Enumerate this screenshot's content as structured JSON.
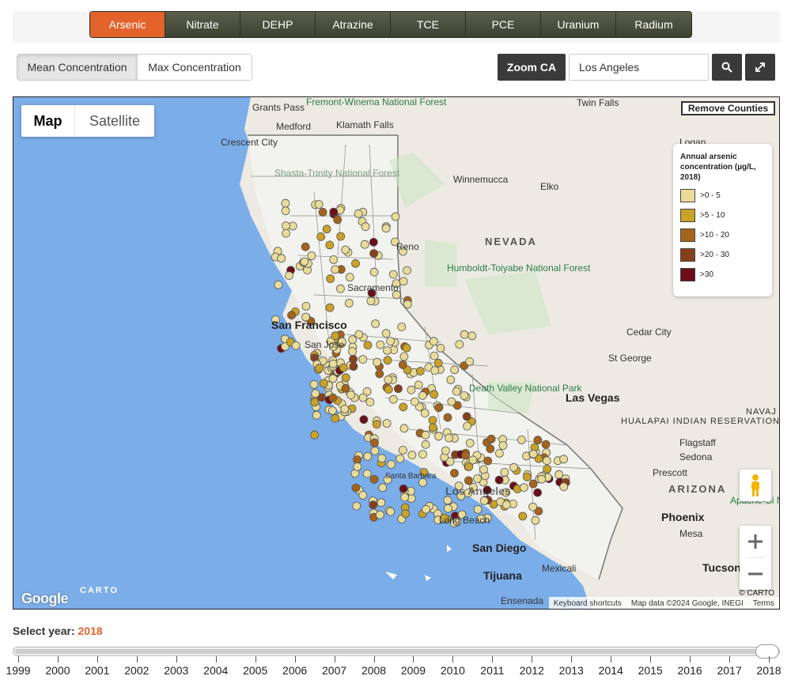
{
  "contaminant_tabs": [
    {
      "label": "Arsenic",
      "active": true
    },
    {
      "label": "Nitrate",
      "active": false
    },
    {
      "label": "DEHP",
      "active": false
    },
    {
      "label": "Atrazine",
      "active": false
    },
    {
      "label": "TCE",
      "active": false
    },
    {
      "label": "PCE",
      "active": false
    },
    {
      "label": "Uranium",
      "active": false
    },
    {
      "label": "Radium",
      "active": false
    }
  ],
  "concentration": {
    "mean_label": "Mean Concentration",
    "max_label": "Max Concentration",
    "selected": "mean"
  },
  "toolbar": {
    "zoom_label": "Zoom CA",
    "search_value": "Los Angeles",
    "search_icon": "search-icon",
    "expand_icon": "expand-icon"
  },
  "map": {
    "map_type_map": "Map",
    "map_type_satellite": "Satellite",
    "selected_type": "Map",
    "remove_counties_label": "Remove Counties",
    "place_labels": [
      "Grants Pass",
      "Fremont-Winema National Forest",
      "Medford",
      "Klamath Falls",
      "Crescent City",
      "Twin Falls",
      "Logan",
      "Shasta-Trinity National Forest",
      "Winnemucca",
      "Elko",
      "Reno",
      "NEVADA",
      "Humboldt-Toiyabe National Forest",
      "Sacramento",
      "San Francisco",
      "San Jose",
      "Cedar City",
      "St George",
      "Death Valley National Park",
      "Las Vegas",
      "HUALAPAI INDIAN RESERVATION",
      "NAVAJ",
      "Flagstaff",
      "Sedona",
      "Prescott",
      "ARIZONA",
      "Apache-Si National",
      "Santa Barbara",
      "Los Angeles",
      "Long Beach",
      "Phoenix",
      "Mesa",
      "San Diego",
      "Tijuana",
      "Mexicali",
      "Ensenada",
      "Tucson"
    ],
    "google_logo": "Google",
    "carto_logo": "CARTO",
    "attribution": {
      "keyboard": "Keyboard shortcuts",
      "data": "Map data ©2024 Google, INEGI",
      "terms": "Terms",
      "carto": "© CARTO"
    },
    "zoom_in_icon": "plus-icon",
    "zoom_out_icon": "minus-icon",
    "pegman_icon": "pegman-icon"
  },
  "legend": {
    "title": "Annual arsenic concentration (µg/L, 2018)",
    "items": [
      {
        "label": ">0 - 5",
        "color": "#e8dc9a"
      },
      {
        "label": ">5 - 10",
        "color": "#c9a227"
      },
      {
        "label": ">10 - 20",
        "color": "#a4641b"
      },
      {
        "label": ">20 - 30",
        "color": "#86401c"
      },
      {
        "label": ">30",
        "color": "#6b0f1a"
      }
    ]
  },
  "year_selector": {
    "label": "Select year:",
    "selected": "2018",
    "years": [
      "1999",
      "2000",
      "2001",
      "2002",
      "2003",
      "2004",
      "2005",
      "2006",
      "2007",
      "2008",
      "2009",
      "2010",
      "2011",
      "2012",
      "2013",
      "2014",
      "2015",
      "2016",
      "2017",
      "2018"
    ]
  },
  "colors": {
    "accent": "#e2632b",
    "tab_dark": "#4a4e3d",
    "button_dark": "#3a3a3a",
    "ocean": "#7bade9"
  }
}
